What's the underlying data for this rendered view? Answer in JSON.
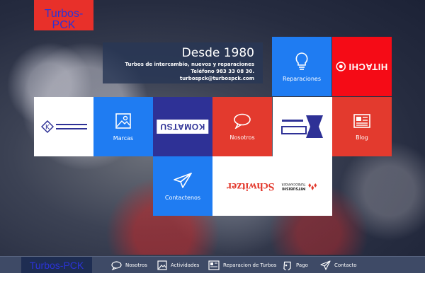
{
  "header": {
    "logo_text": "Turbos-PCK"
  },
  "info": {
    "title": "Desde 1980",
    "line1": "Turbos de intercambio, nuevos y reparaciones",
    "line2": "Teléfono 983 33 08 30.",
    "line3": "turbospck@turbospck.com"
  },
  "tiles": {
    "reparaciones": "Reparaciones",
    "hitachi": "HITACHI",
    "marcas": "Marcas",
    "komatsu": "KOMATSU",
    "nosotros": "Nosotros",
    "blog": "Blog",
    "contactenos": "Contactenos",
    "schwitzer": "Schwitzer",
    "mitsubishi_l1": "MITSUBISHI",
    "mitsubishi_l2": "TURBOCHARGER"
  },
  "taskbar": {
    "logo_text": "Turbos-PCK",
    "items": [
      "Nosotros",
      "Actividades",
      "Reparacion de Turbos",
      "Pago",
      "Contacto"
    ]
  },
  "colors": {
    "blue_tile": "#1f7cf2",
    "red_tile": "#e33a2e",
    "navy_tile": "#2e3196",
    "hitachi_red": "#f50b16",
    "logo_text": "#2b33d6"
  }
}
